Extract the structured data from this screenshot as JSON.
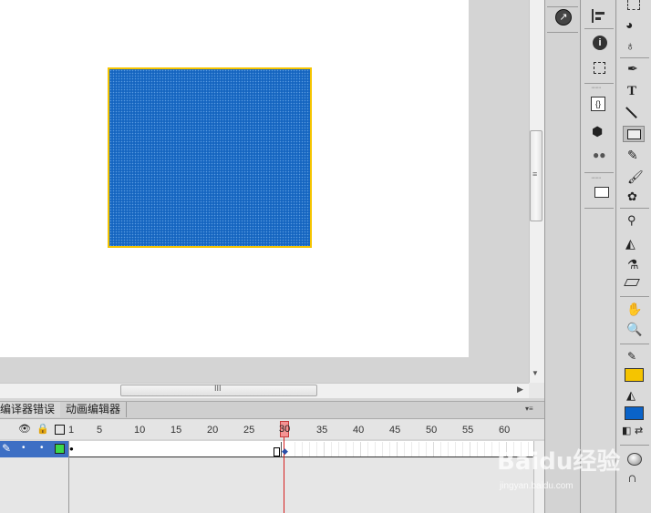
{
  "timeline": {
    "tabs": [
      "编译器错误",
      "动画编辑器"
    ],
    "frame_numbers": [
      "1",
      "5",
      "10",
      "15",
      "20",
      "25",
      "30",
      "35",
      "40",
      "45",
      "50",
      "55",
      "60"
    ],
    "current_frame": "30"
  },
  "colors": {
    "fill_color": "#f5c400",
    "stroke_color": "#0a63c9",
    "shape_fill": "#1565c0",
    "shape_outline": "#f5c400",
    "layer_color": "#3cd84a"
  },
  "scrollbars": {
    "grip_glyph": "III"
  },
  "toolbar": {
    "text_tool_label": "T"
  },
  "watermark": {
    "brand": "Baidu经验",
    "url": "jingyan.baidu.com"
  }
}
